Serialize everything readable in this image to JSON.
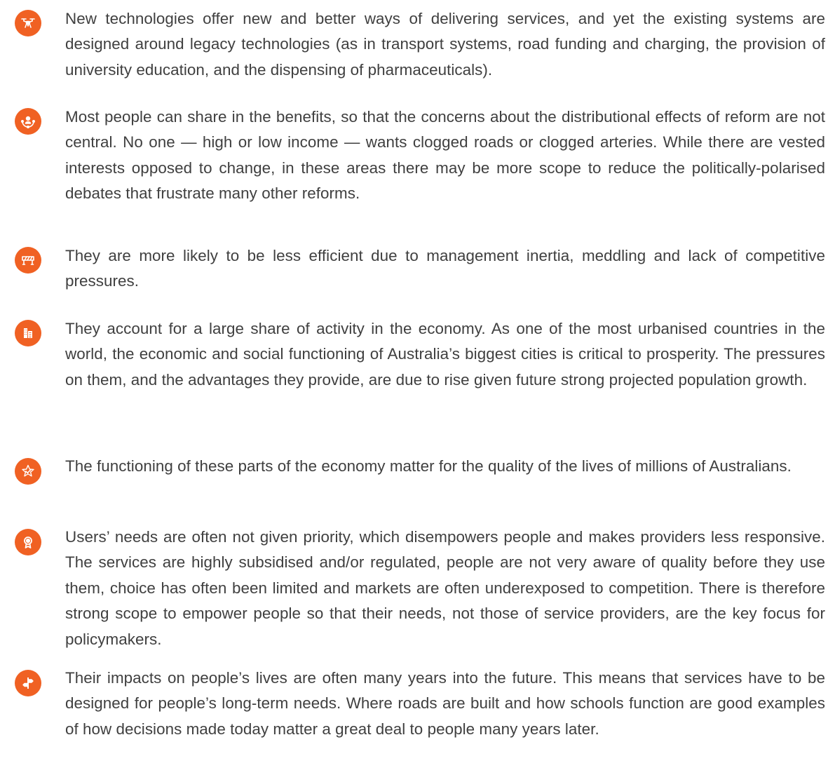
{
  "accent_color": "#f06123",
  "items": [
    {
      "icon": "drone-icon",
      "text": "New technologies offer new and better ways of delivering services, and yet the existing systems are designed around legacy technologies (as in transport systems, road funding and charging, the provision of university education, and the dispensing of pharmaceuticals)."
    },
    {
      "icon": "people-network-icon",
      "text": "Most people can share in the benefits, so that the concerns about the distributional effects of reform are not central. No one — high or low income — wants clogged roads or clogged arteries. While there are vested interests opposed to change, in these areas there may be more scope to reduce the politically-polarised debates that frustrate many other reforms."
    },
    {
      "icon": "roadblock-icon",
      "text": "They are more likely to be less efficient due to management inertia, meddling and lack of competitive  pressures."
    },
    {
      "icon": "city-buildings-icon",
      "text": "They account for a large share of activity in the economy. As one of the most urbanised countries in the world, the economic and social functioning of Australia’s biggest cities is critical to prosperity. The pressures on them, and the advantages they provide, are due to rise given future strong projected population growth."
    },
    {
      "icon": "star-check-icon",
      "text": "The functioning of these parts of the economy matter for the quality of the lives of millions of Australians."
    },
    {
      "icon": "award-ribbon-icon",
      "text": "Users’ needs are often not given priority, which disempowers people and makes providers less responsive. The services are highly subsidised and/or regulated, people are not very aware of quality before they use them, choice has often been limited and markets are often underexposed to competition. There is therefore strong scope to empower people so that their needs, not those of service providers, are the key focus for policymakers."
    },
    {
      "icon": "signpost-icon",
      "text": "Their impacts on people’s lives are often many years into the future. This means that services have to be designed for people’s long-term needs. Where roads are built and how schools function are good examples of how decisions made today matter a great deal to people many years later."
    }
  ]
}
